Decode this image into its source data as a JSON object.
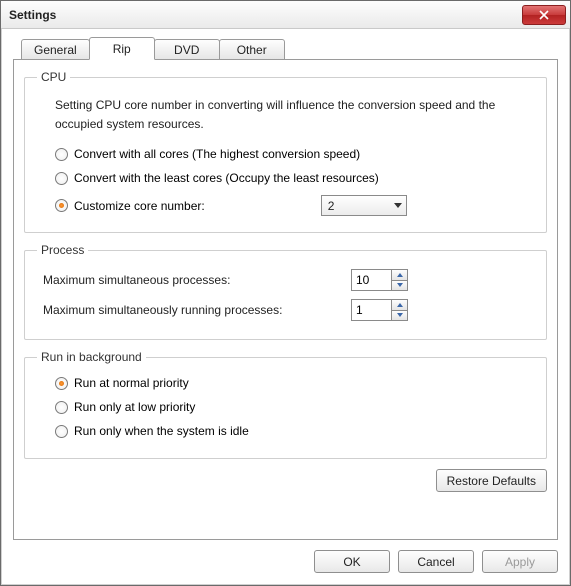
{
  "window": {
    "title": "Settings"
  },
  "tabs": {
    "general": "General",
    "rip": "Rip",
    "dvd": "DVD",
    "other": "Other"
  },
  "cpu": {
    "legend": "CPU",
    "desc": "Setting CPU core number in converting will influence the conversion speed and the occupied system resources.",
    "opt_all": "Convert with all cores (The highest conversion speed)",
    "opt_least": "Convert with the least cores (Occupy the least resources)",
    "opt_custom": "Customize core number:",
    "core_value": "2"
  },
  "process": {
    "legend": "Process",
    "max_sim": "Maximum simultaneous processes:",
    "max_sim_val": "10",
    "max_run": "Maximum simultaneously running processes:",
    "max_run_val": "1"
  },
  "runbg": {
    "legend": "Run in background",
    "opt_normal": "Run at normal priority",
    "opt_low": "Run only at low priority",
    "opt_idle": "Run only when the system is idle"
  },
  "buttons": {
    "restore": "Restore Defaults",
    "ok": "OK",
    "cancel": "Cancel",
    "apply": "Apply"
  }
}
